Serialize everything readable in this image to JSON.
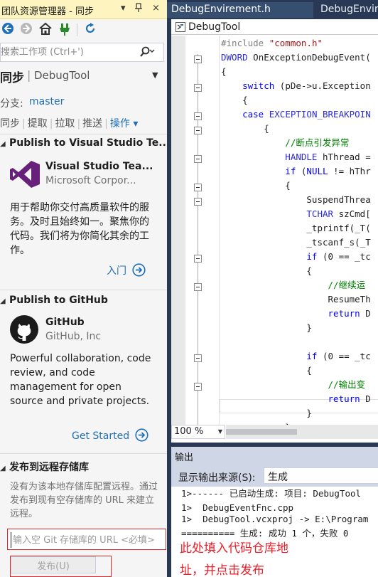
{
  "team_explorer": {
    "title": "团队资源管理器 - 同步",
    "pin_glyph": "▾ ⊥ ×",
    "search_placeholder": "搜索工作项 (Ctrl+')",
    "header_main": "同步",
    "header_sep": "|",
    "header_sub": "DebugTool",
    "branch_label": "分支:",
    "branch_value": "master",
    "actions": [
      "同步",
      "提取",
      "拉取",
      "推送"
    ],
    "actions_menu": "操作 ▾",
    "vsts": {
      "section": "Publish to Visual Studio Te...",
      "name": "Visual Studio Tea...",
      "publisher": "Microsoft Corpor...",
      "description": "用于帮助你交付高质量软件的服务。及时且始终如一。聚焦你的代码。我们将为你简化其余的工作。",
      "link": "入门"
    },
    "github": {
      "section": "Publish to GitHub",
      "name": "GitHub",
      "publisher": "GitHub, Inc",
      "description": "Powerful collaboration, code review, and code management for open source and private projects.",
      "link": "Get Started"
    },
    "remote": {
      "section": "发布到远程存储库",
      "description": "没有为该本地存储库配置远程。通过发布到现有空存储库的 URL 来建立远程。",
      "url_placeholder": "输入空 Git 存储库的 URL <必填>",
      "publish_button": "发布(U)"
    }
  },
  "editor": {
    "tab_active": "DebugEnvirement.h",
    "tab_inactive": "DebugEnvir",
    "nav_function": "DebugTool",
    "code_lines": [
      [
        [
          "pp",
          "#include "
        ],
        [
          "str",
          "\"common.h\""
        ]
      ],
      [
        [
          "ty",
          "DWORD"
        ],
        [
          "id",
          " OnExceptionDebugEvent("
        ]
      ],
      [
        [
          "id",
          "{"
        ]
      ],
      [
        [
          "kw",
          "    switch"
        ],
        [
          "id",
          " (pDe->u.Exception"
        ]
      ],
      [
        [
          "id",
          "    {"
        ]
      ],
      [
        [
          "kw",
          "    case"
        ],
        [
          "ty",
          " EXCEPTION_BREAKPOIN"
        ]
      ],
      [
        [
          "id",
          "        {"
        ]
      ],
      [
        [
          "cm",
          "            //断点引发异常"
        ]
      ],
      [
        [
          "ty",
          "            HANDLE"
        ],
        [
          "id",
          " hThread = "
        ]
      ],
      [
        [
          "kw",
          "            if"
        ],
        [
          "id",
          " ("
        ],
        [
          "kw",
          "NULL"
        ],
        [
          "id",
          " != hThr"
        ]
      ],
      [
        [
          "id",
          "            {"
        ]
      ],
      [
        [
          "id",
          "                SuspendThrea"
        ]
      ],
      [
        [
          "ty",
          "                TCHAR"
        ],
        [
          "id",
          " szCmd["
        ]
      ],
      [
        [
          "id",
          "                _tprintf(_T("
        ]
      ],
      [
        [
          "id",
          "                _tscanf_s(_T"
        ]
      ],
      [
        [
          "kw",
          "                if"
        ],
        [
          "id",
          " (0 == _tc"
        ]
      ],
      [
        [
          "id",
          "                {"
        ]
      ],
      [
        [
          "cm",
          "                    //继续运"
        ]
      ],
      [
        [
          "id",
          "                    ResumeTh"
        ]
      ],
      [
        [
          "kw",
          "                    return"
        ],
        [
          "id",
          " D"
        ]
      ],
      [
        [
          "id",
          "                }"
        ]
      ],
      [
        [
          "id",
          ""
        ]
      ],
      [
        [
          "kw",
          "                if"
        ],
        [
          "id",
          " (0 == _tc"
        ]
      ],
      [
        [
          "id",
          "                {"
        ]
      ],
      [
        [
          "cm",
          "                    //输出变"
        ]
      ],
      [
        [
          "kw",
          "                    return"
        ],
        [
          "id",
          " D"
        ]
      ],
      [
        [
          "id",
          "                }"
        ]
      ],
      [
        [
          "id",
          "            }"
        ]
      ]
    ],
    "zoom": "100 %"
  },
  "output": {
    "title": "输出",
    "source_label": "显示输出来源(S):",
    "source_value": "生成",
    "lines": [
      "1>------ 已启动生成: 项目: DebugTool",
      "1>  DebugEventFnc.cpp",
      "1>  DebugTool.vcxproj -> E:\\Program",
      "========== 生成: 成功 1 个，失败 0"
    ]
  },
  "annotation": {
    "line1": "此处填入代码仓库地",
    "line2": "址，并点击发布"
  },
  "colors": {
    "title_bar": "#fdf4bf",
    "link": "#1e6fb6",
    "annotation": "#e8202a",
    "ide_frame": "#293955"
  }
}
